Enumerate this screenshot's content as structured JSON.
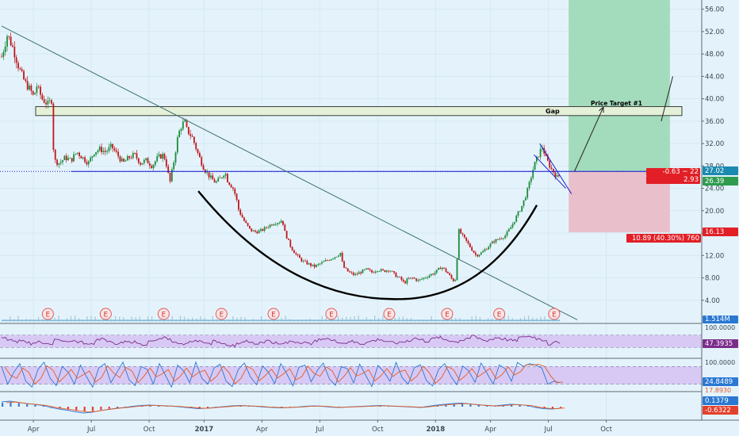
{
  "chart_data": {
    "type": "candlestick",
    "price_axis": {
      "ticks": [
        4,
        8,
        12,
        16,
        20,
        24,
        28,
        32,
        36,
        40,
        44,
        48,
        52,
        56
      ],
      "tick_labels": [
        "4.00",
        "8.00",
        "12.00",
        "16.00",
        "20.00",
        "24.00",
        "28.00",
        "32.00",
        "36.00",
        "40.00",
        "44.00",
        "48.00",
        "52.00",
        "56.00"
      ],
      "ylim": [
        0,
        57.5
      ]
    },
    "time_axis": {
      "labels": [
        "Apr",
        "Jul",
        "Oct",
        "2017",
        "Apr",
        "Jul",
        "Oct",
        "2018",
        "Apr",
        "Jul",
        "Oct"
      ],
      "bold": [
        "2017",
        "2018"
      ]
    },
    "price_path": [
      {
        "t": 0.0,
        "v": 47.5
      },
      {
        "t": 1.0,
        "v": 51.5
      },
      {
        "t": 2.0,
        "v": 49
      },
      {
        "t": 3.0,
        "v": 45.5
      },
      {
        "t": 4.0,
        "v": 43
      },
      {
        "t": 5.0,
        "v": 41.5
      },
      {
        "t": 5.6,
        "v": 40.2
      },
      {
        "t": 6.0,
        "v": 42.5
      },
      {
        "t": 7.0,
        "v": 40
      },
      {
        "t": 8.0,
        "v": 39
      },
      {
        "t": 8.8,
        "v": 40
      },
      {
        "t": 9.0,
        "v": 29
      },
      {
        "t": 10.0,
        "v": 28.5
      },
      {
        "t": 11.0,
        "v": 29.5
      },
      {
        "t": 12.0,
        "v": 29
      },
      {
        "t": 13.0,
        "v": 30.5
      },
      {
        "t": 14.0,
        "v": 29.5
      },
      {
        "t": 15.0,
        "v": 28.5
      },
      {
        "t": 16.0,
        "v": 30.5
      },
      {
        "t": 17.0,
        "v": 31
      },
      {
        "t": 18.0,
        "v": 30.5
      },
      {
        "t": 19.0,
        "v": 31.5
      },
      {
        "t": 20.0,
        "v": 30
      },
      {
        "t": 21.0,
        "v": 28.5
      },
      {
        "t": 22.0,
        "v": 29.5
      },
      {
        "t": 23.0,
        "v": 30
      },
      {
        "t": 24.0,
        "v": 28.5
      },
      {
        "t": 25.0,
        "v": 29
      },
      {
        "t": 26.0,
        "v": 28
      },
      {
        "t": 27.0,
        "v": 29.5
      },
      {
        "t": 28.0,
        "v": 30
      },
      {
        "t": 28.7,
        "v": 27.5
      },
      {
        "t": 29.0,
        "v": 24.5
      },
      {
        "t": 29.8,
        "v": 29
      },
      {
        "t": 30.5,
        "v": 33.5
      },
      {
        "t": 31.0,
        "v": 35
      },
      {
        "t": 31.6,
        "v": 36
      },
      {
        "t": 32.0,
        "v": 34.5
      },
      {
        "t": 33.0,
        "v": 33
      },
      {
        "t": 34.0,
        "v": 30
      },
      {
        "t": 35.0,
        "v": 27.5
      },
      {
        "t": 36.0,
        "v": 26
      },
      {
        "t": 37.0,
        "v": 25
      },
      {
        "t": 38.0,
        "v": 26
      },
      {
        "t": 38.6,
        "v": 27
      },
      {
        "t": 39.0,
        "v": 25.5
      },
      {
        "t": 40.0,
        "v": 24
      },
      {
        "t": 40.5,
        "v": 22.5
      },
      {
        "t": 41.0,
        "v": 20
      },
      {
        "t": 42.0,
        "v": 18
      },
      {
        "t": 43.0,
        "v": 16.5
      },
      {
        "t": 44.0,
        "v": 16.2
      },
      {
        "t": 45.0,
        "v": 16.5
      },
      {
        "t": 46.0,
        "v": 17.2
      },
      {
        "t": 47.0,
        "v": 17.8
      },
      {
        "t": 48.0,
        "v": 18
      },
      {
        "t": 48.5,
        "v": 18.4
      },
      {
        "t": 49.0,
        "v": 16
      },
      {
        "t": 50.0,
        "v": 13.5
      },
      {
        "t": 51.0,
        "v": 12
      },
      {
        "t": 52.0,
        "v": 11
      },
      {
        "t": 53.0,
        "v": 10.5
      },
      {
        "t": 54.0,
        "v": 10
      },
      {
        "t": 55.0,
        "v": 10.5
      },
      {
        "t": 56.0,
        "v": 11
      },
      {
        "t": 57.0,
        "v": 11.5
      },
      {
        "t": 58.0,
        "v": 12
      },
      {
        "t": 58.6,
        "v": 12.5
      },
      {
        "t": 59.0,
        "v": 10
      },
      {
        "t": 60.0,
        "v": 9
      },
      {
        "t": 61.0,
        "v": 8.5
      },
      {
        "t": 62.0,
        "v": 9
      },
      {
        "t": 63.0,
        "v": 9.5
      },
      {
        "t": 64.0,
        "v": 9
      },
      {
        "t": 65.0,
        "v": 9.5
      },
      {
        "t": 66.0,
        "v": 9.2
      },
      {
        "t": 67.0,
        "v": 9.5
      },
      {
        "t": 68.0,
        "v": 8.5
      },
      {
        "t": 69.0,
        "v": 7.8
      },
      {
        "t": 69.6,
        "v": 7
      },
      {
        "t": 70.0,
        "v": 7.6
      },
      {
        "t": 71.0,
        "v": 8
      },
      {
        "t": 72.0,
        "v": 7.5
      },
      {
        "t": 73.0,
        "v": 8
      },
      {
        "t": 74.0,
        "v": 8.5
      },
      {
        "t": 75.0,
        "v": 9
      },
      {
        "t": 76.0,
        "v": 10
      },
      {
        "t": 77.0,
        "v": 9
      },
      {
        "t": 78.0,
        "v": 7.5
      },
      {
        "t": 78.5,
        "v": 7.8
      },
      {
        "t": 79.0,
        "v": 16.5
      },
      {
        "t": 80.0,
        "v": 15
      },
      {
        "t": 81.0,
        "v": 13.5
      },
      {
        "t": 82.0,
        "v": 12
      },
      {
        "t": 83.0,
        "v": 12.5
      },
      {
        "t": 84.0,
        "v": 13.5
      },
      {
        "t": 85.0,
        "v": 14.5
      },
      {
        "t": 86.0,
        "v": 15
      },
      {
        "t": 87.0,
        "v": 15.5
      },
      {
        "t": 88.0,
        "v": 17
      },
      {
        "t": 89.0,
        "v": 19
      },
      {
        "t": 90.0,
        "v": 21
      },
      {
        "t": 91.0,
        "v": 24
      },
      {
        "t": 92.0,
        "v": 28
      },
      {
        "t": 93.0,
        "v": 30.5
      },
      {
        "t": 93.5,
        "v": 31.5
      },
      {
        "t": 94.0,
        "v": 29.5
      },
      {
        "t": 95.0,
        "v": 27.5
      },
      {
        "t": 96.0,
        "v": 26
      },
      {
        "t": 96.5,
        "v": 26.4
      }
    ],
    "volume_line": {
      "t": [
        0,
        96.5
      ],
      "v": [
        0.4,
        0.4
      ]
    },
    "drawings": {
      "gap_zone": {
        "label": "Gap",
        "top": 38.6,
        "bottom": 37.0
      },
      "horizontal_line": {
        "value": 27.02
      },
      "trendline": {
        "t1": 0,
        "v1": 53,
        "t2": 99.5,
        "v2": 0.5
      },
      "cup_curve": {
        "t_start": 34,
        "v_start": 23.5,
        "t_min": 68.5,
        "v_min": 4.2,
        "t_end": 92.5,
        "v_end": 21
      },
      "falling_channel": [
        {
          "t1": 93.0,
          "v1": 32,
          "t2": 98.5,
          "v2": 23
        },
        {
          "t1": 92.0,
          "v1": 30,
          "t2": 97.5,
          "v2": 24
        }
      ],
      "target_arrow": {
        "t1": 99,
        "v1": 27,
        "t2": 104,
        "v2": 38.5,
        "label": "Price Target #1"
      },
      "extension_line": {
        "t1": 114,
        "v1": 36,
        "t2": 116,
        "v2": 44
      },
      "long_position": {
        "t_start": 98,
        "t_end": 115.5,
        "profit_top": 58,
        "entry": 27.02,
        "stop": 16.13
      }
    },
    "earnings_marker": "E",
    "earnings_t": [
      8,
      18,
      28,
      38,
      47,
      57,
      67,
      77,
      86,
      95.5
    ],
    "rsi": {
      "range": [
        0,
        100
      ],
      "band": [
        30,
        70
      ],
      "current": 47.3935,
      "path": [
        60,
        55,
        48,
        52,
        47,
        42,
        50,
        45,
        38,
        55,
        50,
        46,
        52,
        48,
        44,
        40,
        55,
        58,
        50,
        42,
        45,
        52,
        48,
        44,
        38,
        50,
        55,
        62,
        58,
        50,
        45,
        40,
        46,
        52,
        48,
        42,
        50,
        45,
        40,
        36,
        44,
        50,
        46,
        42,
        48,
        52,
        46,
        40,
        44,
        50,
        48,
        46,
        42,
        50,
        55,
        60,
        52,
        48,
        44,
        50,
        46,
        42,
        48,
        52,
        56,
        50,
        46,
        44,
        48,
        52,
        60,
        55,
        50,
        58,
        62,
        56,
        52,
        48,
        54,
        60,
        66,
        58,
        52,
        56,
        62,
        58,
        54,
        52,
        62,
        66,
        64,
        58,
        54,
        40,
        46,
        47
      ]
    },
    "stoch": {
      "range": [
        0,
        100
      ],
      "band": [
        20,
        80
      ],
      "current": 24.8489,
      "k": [
        80,
        20,
        60,
        90,
        30,
        10,
        70,
        95,
        40,
        15,
        80,
        60,
        20,
        85,
        45,
        10,
        75,
        90,
        25,
        60,
        95,
        35,
        15,
        80,
        70,
        20,
        90,
        50,
        10,
        85,
        65,
        25,
        95,
        40,
        20,
        75,
        88,
        30,
        12,
        70,
        92,
        45,
        18,
        82,
        60,
        22,
        90,
        55,
        14,
        78,
        85,
        28,
        66,
        92,
        38,
        16,
        80,
        72,
        24,
        88,
        50,
        12,
        84,
        62,
        30,
        94,
        42,
        20,
        76,
        86,
        32,
        14,
        70,
        90,
        48,
        18,
        82,
        64,
        26,
        92,
        56,
        20,
        86,
        72,
        30,
        94,
        80,
        90,
        85,
        75,
        20,
        30,
        25
      ]
    },
    "macd": {
      "current": [
        0.1379,
        -0.6322
      ],
      "hist": [
        1.2,
        1.4,
        1.1,
        0.8,
        0.6,
        0.3,
        -0.2,
        -0.6,
        -0.9,
        -1.3,
        -1.6,
        -1.4,
        -1.0,
        -0.7,
        -0.4,
        -0.2,
        0.1,
        0.3,
        0.4,
        0.3,
        0.2,
        0.1,
        -0.1,
        -0.3,
        -0.5,
        -0.4,
        -0.2,
        0,
        0.2,
        0.3,
        0.2,
        0.1,
        -0.1,
        -0.2,
        -0.3,
        -0.2,
        -0.1,
        0.1,
        0.2,
        0.1,
        -0.1,
        -0.2,
        -0.1,
        0,
        0.1,
        0.2,
        0.3,
        0.2,
        0.1,
        0,
        -0.1,
        -0.2,
        0.1,
        0.4,
        0.6,
        0.8,
        0.9,
        0.7,
        0.5,
        0.3,
        0.2,
        0.4,
        0.6,
        0.5,
        0.3,
        -0.2,
        -0.5,
        -0.6,
        -0.4
      ]
    }
  },
  "price_labels": {
    "last_price": "27.02",
    "change": "-0.63 ~ 22",
    "target_diff": "2.93",
    "stop_price": "16.13",
    "entry": "26.39",
    "stop_info": "10.89 (40.30%) 760"
  },
  "volume_label": "1.514M",
  "rsi_labels": {
    "top": "100.0000",
    "value": "47.3935"
  },
  "stoch_labels": {
    "top": "100.0000",
    "value": "24.8489",
    "hidden": "17.8930"
  },
  "macd_labels": {
    "value1": "0.1379",
    "value2": "-0.6322"
  },
  "colors": {
    "background": "#e4f3fb",
    "up": "#1b8a3a",
    "down": "#c0161c",
    "gap_fill": "#e4f1d8",
    "horizontal": "#1a1ad0",
    "trend": "#3f6f6c",
    "profit": "#a3dbbd",
    "loss": "#e9bfcb",
    "rsi": "#7b2d8b",
    "rsi_band": "#d7c9f4",
    "stoch_k": "#2a78d2",
    "stoch_d": "#e35d25",
    "macd_up": "#3a7bd5",
    "macd_down": "#e4402d"
  }
}
